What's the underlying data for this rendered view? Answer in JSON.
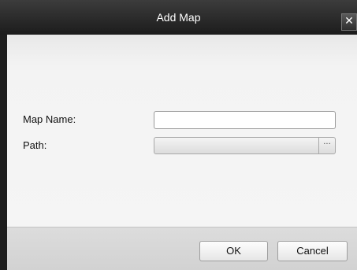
{
  "dialog": {
    "title": "Add Map",
    "close_glyph": "✕",
    "close_icon": "close-icon"
  },
  "form": {
    "map_name_label": "Map Name:",
    "map_name_value": "",
    "path_label": "Path:",
    "path_value": "",
    "browse_glyph": "···",
    "browse_icon": "ellipsis-icon"
  },
  "footer": {
    "ok_label": "OK",
    "cancel_label": "Cancel"
  },
  "colors": {
    "titlebar": "#262626",
    "body": "#f3f3f3",
    "footer": "#d8d8d8"
  }
}
